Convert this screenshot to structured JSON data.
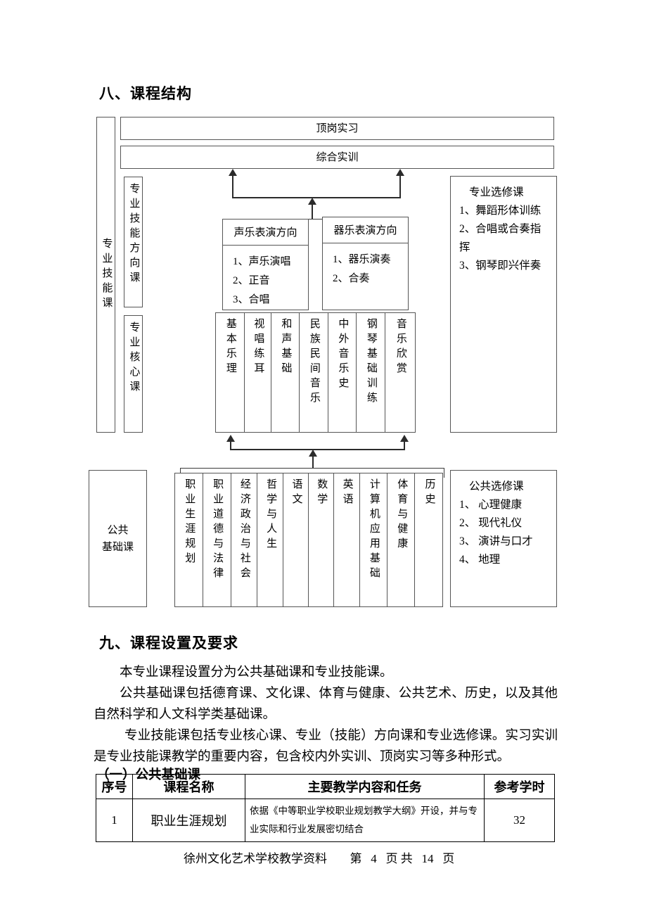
{
  "section8": {
    "heading": "八、课程结构",
    "top_boxes": [
      {
        "label": "顶岗实习"
      },
      {
        "label": "综合实训"
      }
    ],
    "left_spine": {
      "label": "专业技能课"
    },
    "left_sub_boxes": [
      {
        "label": "专业技能方向课"
      },
      {
        "label": "专业核心课"
      }
    ],
    "direction_boxes": [
      {
        "title": "声乐表演方向",
        "items": [
          "1、声乐演唱",
          "2、正音",
          "3、合唱"
        ]
      },
      {
        "title": "器乐表演方向",
        "items": [
          "1、器乐演奏",
          "2、合奏"
        ]
      }
    ],
    "major_elective": {
      "title": "专业选修课",
      "items": [
        "1、舞蹈形体训练",
        "2、合唱或合奏指",
        "挥",
        "3、钢琴即兴伴奏"
      ]
    },
    "core_courses": [
      "基本乐理",
      "视唱练耳",
      "和声基础",
      "民族民间音乐",
      "中外音乐史",
      "钢琴基础训练",
      "音乐欣赏"
    ],
    "public_spine": {
      "label_line1": "公共",
      "label_line2": "基础课"
    },
    "public_courses": [
      "职业生涯规划",
      "职业道德与法律",
      "经济政治与社会",
      "哲学与人生",
      "语文",
      "数学",
      "英语",
      "计算机应用基础",
      "体育与健康",
      "历史"
    ],
    "public_elective": {
      "title": "公共选修课",
      "items": [
        "1、 心理健康",
        "2、 现代礼仪",
        "3、 演讲与口才",
        "4、 地理"
      ]
    }
  },
  "section9": {
    "heading": "九、课程设置及要求",
    "paragraphs": [
      "本专业课程设置分为公共基础课和专业技能课。",
      "公共基础课包括德育课、文化课、体育与健康、公共艺术、历史，以及其他自然科学和人文科学类基础课。",
      "专业技能课包括专业核心课、专业（技能）方向课和专业选修课。实习实训是专业技能课教学的重要内容，包含校内外实训、顶岗实习等多种形式。"
    ],
    "subheading": "（一）公共基础课",
    "table": {
      "headers": [
        "序号",
        "课程名称",
        "主要教学内容和任务",
        "参考学时"
      ],
      "rows": [
        {
          "num": "1",
          "name": "职业生涯规划",
          "desc": "依据《中等职业学校职业规划教学大纲》开设，并与专业实际和行业发展密切结合",
          "hours": "32"
        }
      ]
    }
  },
  "footer": {
    "source": "徐州文化艺术学校教学资料",
    "page_prefix": "第",
    "page_number": "4",
    "page_mid": "页  共",
    "total_pages": "14",
    "page_suffix": "页"
  }
}
